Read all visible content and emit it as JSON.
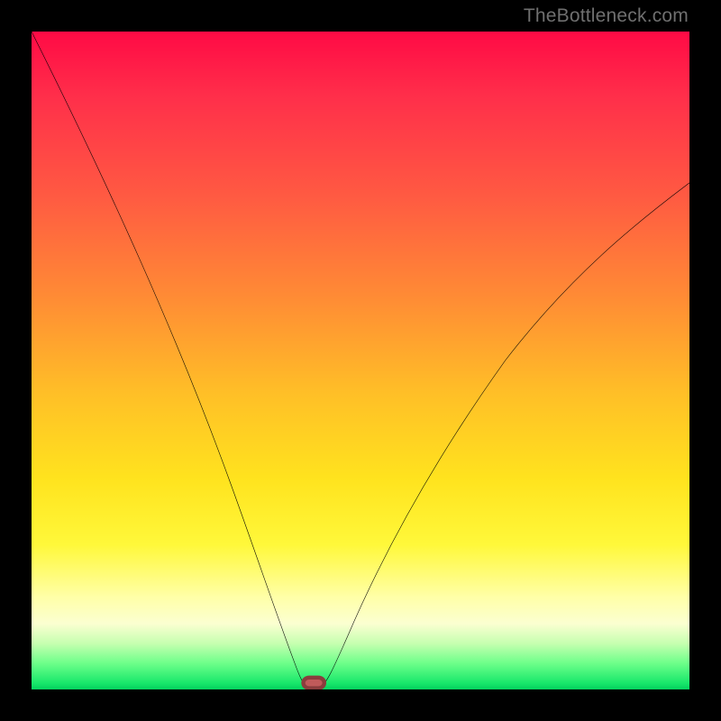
{
  "watermark": "TheBottleneck.com",
  "chart_data": {
    "type": "line",
    "title": "",
    "xlabel": "",
    "ylabel": "",
    "xlim": [
      0,
      100
    ],
    "ylim": [
      0,
      100
    ],
    "grid": false,
    "series": [
      {
        "name": "bottleneck-curve",
        "x": [
          0,
          5,
          10,
          15,
          20,
          25,
          30,
          35,
          38,
          40,
          41,
          42,
          43,
          44,
          45,
          50,
          55,
          60,
          65,
          70,
          75,
          80,
          85,
          90,
          95,
          100
        ],
        "values": [
          100,
          89,
          78,
          66,
          54,
          42,
          30,
          18,
          10,
          4,
          2,
          0,
          0,
          0,
          2,
          10,
          20,
          29,
          37,
          45,
          52,
          58,
          64,
          69,
          73,
          77
        ]
      }
    ],
    "annotations": [
      {
        "name": "optimal-marker",
        "x": 42.5,
        "y": 0
      }
    ],
    "background_gradient": {
      "stops": [
        {
          "pos": 0.0,
          "color": "#ff0a45"
        },
        {
          "pos": 0.25,
          "color": "#ff5a42"
        },
        {
          "pos": 0.55,
          "color": "#ffbf27"
        },
        {
          "pos": 0.78,
          "color": "#fff83a"
        },
        {
          "pos": 0.9,
          "color": "#fbffd1"
        },
        {
          "pos": 0.96,
          "color": "#6eff8a"
        },
        {
          "pos": 1.0,
          "color": "#04d15e"
        }
      ]
    }
  }
}
